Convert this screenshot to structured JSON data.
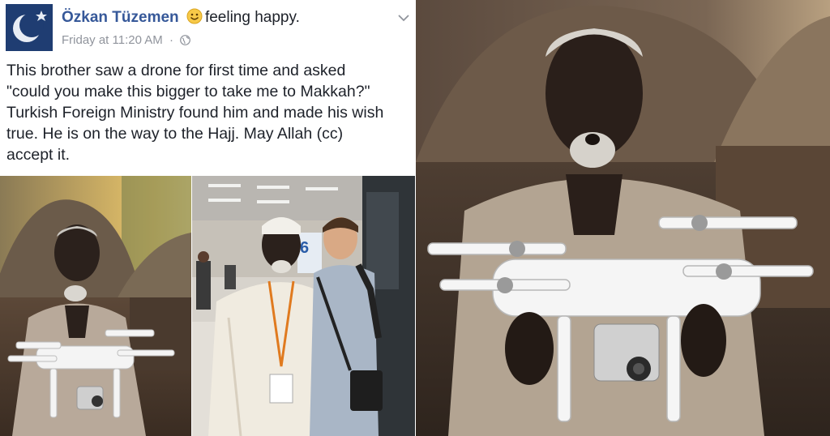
{
  "post": {
    "author": "Özkan Tüzemen",
    "feeling": "feeling happy.",
    "timestamp": "Friday at 11:20 AM",
    "separator": "·",
    "text_lines": [
      "This brother saw a drone for first time and asked",
      "\"could you make this bigger to take me to Makkah?\"",
      "Turkish Foreign Ministry found him and made his wish",
      "true. He is on the way to the Hajj. May Allah (cc)",
      "accept it."
    ],
    "icons": {
      "avatar": "crescent-star-avatar",
      "feeling": "smiley-icon",
      "privacy": "globe-icon",
      "menu": "chevron-down-icon"
    }
  },
  "photos": {
    "sign_number": "6"
  },
  "colors": {
    "author_link": "#365899",
    "meta_text": "#90949c",
    "body_text": "#1d2129",
    "avatar_bg": "#1f3d72"
  }
}
